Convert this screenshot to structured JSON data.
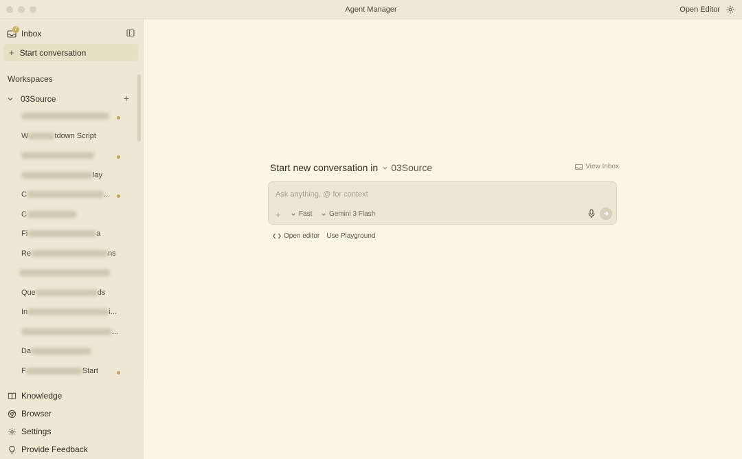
{
  "window": {
    "title": "Agent Manager",
    "open_editor": "Open Editor"
  },
  "sidebar": {
    "inbox_label": "Inbox",
    "inbox_badge": "7",
    "start_conversation": "Start conversation",
    "workspaces_header": "Workspaces",
    "workspace_name": "03Source",
    "conversations": [
      {
        "prefix": "",
        "suffix": "",
        "dot": true
      },
      {
        "prefix": "W",
        "suffix": "tdown Script",
        "dot": false
      },
      {
        "prefix": "",
        "suffix": "",
        "dot": true
      },
      {
        "prefix": "",
        "suffix": "lay",
        "dot": false
      },
      {
        "prefix": "C",
        "suffix": "...",
        "dot": true
      },
      {
        "prefix": "C",
        "suffix": "",
        "dot": false
      },
      {
        "prefix": "Fi",
        "suffix": "a",
        "dot": false
      },
      {
        "prefix": "Re",
        "suffix": "ns",
        "dot": false
      },
      {
        "prefix": "",
        "suffix": "",
        "dot": false
      },
      {
        "prefix": "Que",
        "suffix": "ds",
        "dot": false
      },
      {
        "prefix": "In",
        "suffix": "i...",
        "dot": false
      },
      {
        "prefix": "",
        "suffix": "...",
        "dot": false
      },
      {
        "prefix": "Da",
        "suffix": "",
        "dot": false
      },
      {
        "prefix": "F",
        "suffix": "Start",
        "dot": true
      }
    ],
    "nav": {
      "knowledge": "Knowledge",
      "browser": "Browser",
      "settings": "Settings",
      "feedback": "Provide Feedback"
    }
  },
  "main": {
    "heading": "Start new conversation in",
    "workspace": "03Source",
    "view_inbox": "View Inbox",
    "composer": {
      "placeholder": "Ask anything, @ for context",
      "mode": "Fast",
      "model": "Gemini 3 Flash"
    },
    "open_editor_link": "Open editor",
    "use_playground": "Use Playground"
  }
}
